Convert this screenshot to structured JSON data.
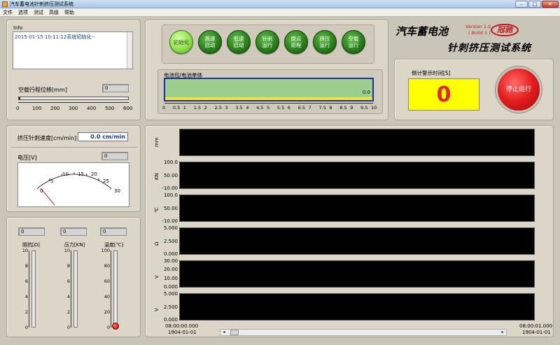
{
  "window": {
    "title": "汽车蓄电池针刺挤压测试系统"
  },
  "menu": [
    "文件",
    "选项",
    "测试",
    "高级",
    "帮助"
  ],
  "info": {
    "label": "Info",
    "log": "2015-01-15 10:11:12系统初始化--"
  },
  "stroke": {
    "label": "空载行程位移[mm]",
    "value": "0",
    "ticks": [
      "0",
      "100",
      "200",
      "300",
      "400",
      "500",
      "600"
    ]
  },
  "buttons": [
    "初始化",
    "高速\n启动",
    "低速\n启动",
    "针刺\n运行",
    "原点\n返程",
    "挤压\n运行",
    "空载\n运行"
  ],
  "active_button": 0,
  "progress": {
    "label": "电池包/电池单体",
    "value": "0.0",
    "fill": 0.0,
    "ticks": [
      "0",
      "0.5",
      "1",
      "1.5",
      "2",
      "2.5",
      "3",
      "3.5",
      "4",
      "4.5",
      "5",
      "5.5",
      "6",
      "6.5",
      "7",
      "7.5",
      "8",
      "8.5",
      "9",
      "9.5",
      "10"
    ]
  },
  "brand": {
    "title": "汽车蓄电池",
    "subtitle": "针刺挤压测试系统",
    "version": "Version 1.0",
    "build": "( Build 1 )",
    "logo": "冠驰"
  },
  "countdown": {
    "label": "倒计警示时间[S]",
    "value": "0"
  },
  "stop": {
    "label": "停止运行"
  },
  "speed": {
    "label": "挤压针刺速度[cm/min]",
    "value": "0.0 cm/min"
  },
  "voltage": {
    "label": "电压[V]",
    "value": "0",
    "ticks": [
      "0",
      "5",
      "10",
      "15",
      "20",
      "25",
      "30"
    ],
    "reading": 0
  },
  "thermo": [
    {
      "label": "阻抗[Ω]",
      "value": "0",
      "max": "10",
      "ticks": [
        "10",
        "8",
        "6",
        "4",
        "2",
        "0"
      ],
      "level": 0
    },
    {
      "label": "压力[KN]",
      "value": "0",
      "max": "10",
      "ticks": [
        "10",
        "8",
        "6",
        "4",
        "2",
        "0"
      ],
      "level": 0
    },
    {
      "label": "温度[℃]",
      "value": "0",
      "max": "100",
      "ticks": [
        "100",
        "80",
        "60",
        "40",
        "20",
        "0"
      ],
      "level": 0
    }
  ],
  "charts": [
    {
      "unit": "mm",
      "ticks": []
    },
    {
      "unit": "KN",
      "ticks": [
        "100.0",
        "50.00",
        "-10.00"
      ]
    },
    {
      "unit": "℃",
      "ticks": [
        "100.0",
        "50.00",
        "-10.00"
      ]
    },
    {
      "unit": "Ω",
      "ticks": [
        "5.000",
        "2.500",
        "0.000"
      ]
    },
    {
      "unit": "V",
      "ticks": [
        "30.00",
        "20.00",
        "10.00",
        "0.000"
      ]
    },
    {
      "unit": "V",
      "ticks": [
        "5.000",
        "2.500",
        "0.000"
      ]
    }
  ],
  "time_axis": {
    "start_time": "08:00:00.000",
    "start_date": "1904-01-01",
    "end_time": "08:00:01.000",
    "end_date": "1904-01-01"
  },
  "colors": {
    "panel": "#dbd6c8",
    "accent_red": "#e0262a",
    "countdown_bg": "#ffff00"
  }
}
